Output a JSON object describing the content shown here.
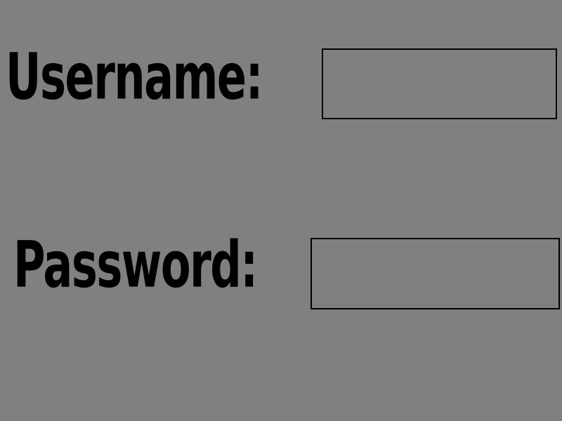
{
  "theme": {
    "background": "#808080",
    "text_color": "#000000",
    "border_color": "#000000"
  },
  "login_form": {
    "username": {
      "label": "Username:",
      "value": "",
      "placeholder": ""
    },
    "password": {
      "label": "Password:",
      "value": "",
      "placeholder": ""
    }
  }
}
